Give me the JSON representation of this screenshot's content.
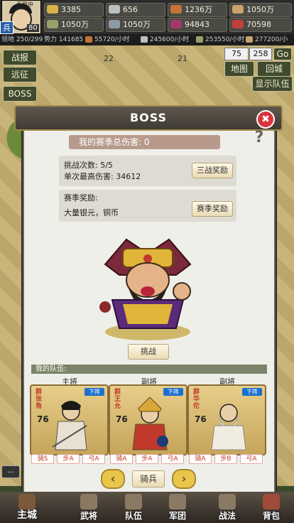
{
  "top": {
    "avatar_title": "责罚中",
    "rank": "兵",
    "level": "80",
    "resources": [
      {
        "icon": "gold-icon",
        "value": "3385"
      },
      {
        "icon": "silver-icon",
        "value": "656"
      },
      {
        "icon": "food-icon",
        "value": "1236万"
      },
      {
        "icon": "wood-icon",
        "value": "1050万"
      },
      {
        "icon": "stone-icon",
        "value": "1050万"
      },
      {
        "icon": "iron-icon",
        "value": "1050万"
      },
      {
        "icon": "gem-icon",
        "value": "94843"
      },
      {
        "icon": "token-icon",
        "value": "70598"
      }
    ],
    "stats": {
      "territory": "领地 250/299",
      "power": "势力 141685",
      "rate1": "245600/小时",
      "rate2": "55720/小时",
      "rate3": "253550/小时",
      "rate4": "277200/小时"
    }
  },
  "sidebar": {
    "battle_report": "战报",
    "expedition": "远征",
    "boss": "BOSS"
  },
  "map_controls": {
    "x": "75",
    "y": "258",
    "go": "Go",
    "map": "地图",
    "return_city": "回城",
    "show_team": "显示队伍",
    "tile_a": "22",
    "tile_b": "21"
  },
  "dialog": {
    "title": "BOSS",
    "close": "✖",
    "help": "?",
    "season_damage": "我的赛季总伤害: 0",
    "challenges": "挑战次数: 5/5",
    "best_damage": "单次最高伤害: 34612",
    "three_battle_reward": "三战奖励",
    "season_reward_label": "赛季奖励:",
    "season_reward_items": "大量银元，铜币",
    "season_reward_button": "赛季奖励",
    "challenge_button": "挑战",
    "team_label": "我的队伍:",
    "team": [
      {
        "role": "主将",
        "name": "张角",
        "faction": "群",
        "level": "76",
        "action": "下阵",
        "tags": [
          "骑S",
          "步A",
          "弓A"
        ]
      },
      {
        "role": "副将",
        "name": "王允",
        "faction": "群",
        "level": "76",
        "action": "下阵",
        "tags": [
          "骑A",
          "步A",
          "弓A"
        ]
      },
      {
        "role": "副将",
        "name": "华佗",
        "faction": "群",
        "level": "76",
        "action": "下阵",
        "tags": [
          "骑A",
          "步B",
          "弓A"
        ]
      }
    ],
    "troop_type": "骑兵",
    "prev": "‹",
    "next": "›"
  },
  "bottom_nav": [
    {
      "label": "主城",
      "icon": "city-icon"
    },
    {
      "label": "武将",
      "icon": "general-icon"
    },
    {
      "label": "队伍",
      "icon": "team-icon"
    },
    {
      "label": "军团",
      "icon": "legion-icon"
    },
    {
      "label": "战法",
      "icon": "tactics-icon"
    },
    {
      "label": "背包",
      "icon": "bag-icon"
    }
  ],
  "chat_button": "..."
}
